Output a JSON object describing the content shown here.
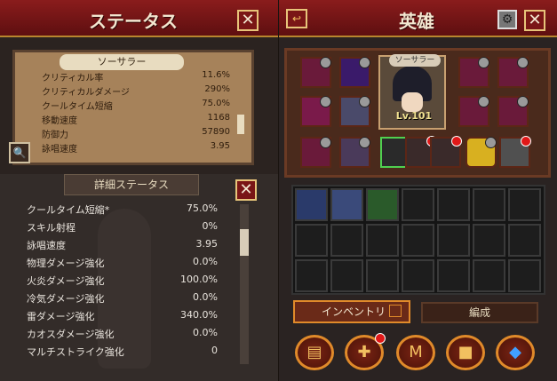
{
  "left": {
    "title": "ステータス",
    "close": "✕",
    "class_label": "ソーサラー",
    "stats": [
      {
        "k": "クリティカル率",
        "v": "11.6%"
      },
      {
        "k": "クリティカルダメージ",
        "v": "290%"
      },
      {
        "k": "クールタイム短縮",
        "v": "75.0%"
      },
      {
        "k": "移動速度",
        "v": "1168"
      },
      {
        "k": "防御力",
        "v": "57890"
      },
      {
        "k": "詠唱速度",
        "v": "3.95"
      }
    ],
    "search_icon": "🔍",
    "detail_title": "詳細ステータス",
    "details": [
      {
        "k": "クールタイム短縮*",
        "v": "75.0%"
      },
      {
        "k": "スキル射程",
        "v": "0%"
      },
      {
        "k": "詠唱速度",
        "v": "3.95"
      },
      {
        "k": "物理ダメージ強化",
        "v": "0.0%"
      },
      {
        "k": "火炎ダメージ強化",
        "v": "100.0%"
      },
      {
        "k": "冷気ダメージ強化",
        "v": "0.0%"
      },
      {
        "k": "雷ダメージ強化",
        "v": "340.0%"
      },
      {
        "k": "カオスダメージ強化",
        "v": "0.0%"
      },
      {
        "k": "マルチストライク強化",
        "v": "0"
      }
    ]
  },
  "right": {
    "title": "英雄",
    "close": "✕",
    "hero_name": "ソーサラー",
    "level": "Lv.101",
    "inventory_label": "インベントリ",
    "formation_label": "編成",
    "colors": {
      "accent": "#e08a2a",
      "red": "#8a1c1c"
    }
  }
}
